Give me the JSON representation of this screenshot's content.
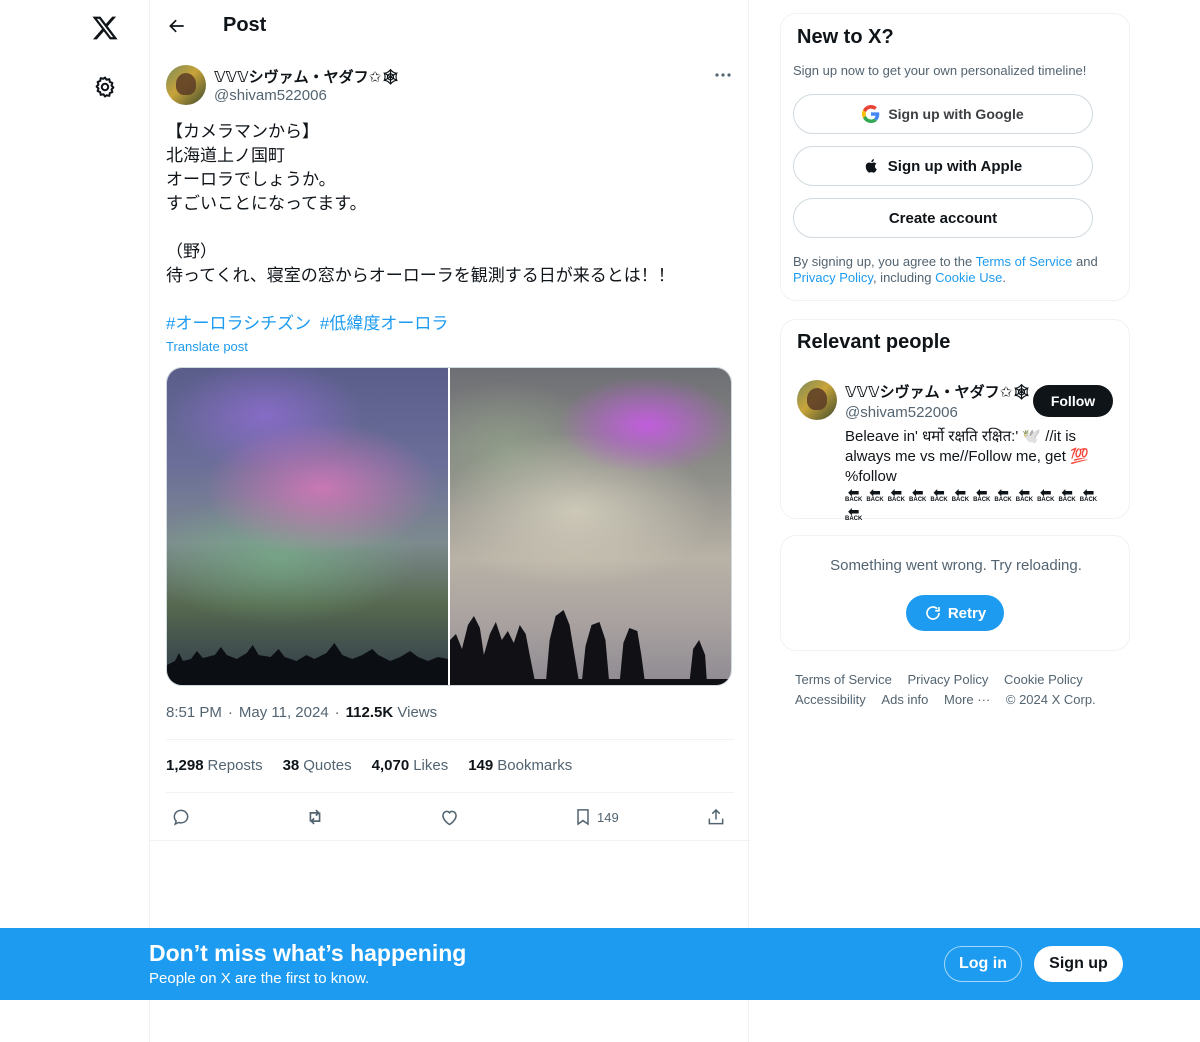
{
  "nav": {
    "logo_icon": "x-logo-icon",
    "settings_icon": "gear-icon"
  },
  "header": {
    "title": "Post",
    "back_icon": "arrow-left-icon"
  },
  "post": {
    "author_name": "𝕍𝕍𝕍シヴァム・ヤダフ✩🕸",
    "author_handle": "@shivam522006",
    "more_icon": "ellipsis-icon",
    "text": "【カメラマンから】\n北海道上ノ国町\nオーロラでしょうか。\nすごいことになってます。\n\n（野）\n待ってくれ、寝室の窓からオーローラを観測する日が来るとは！！",
    "hashtags": [
      "#オーロラシチズン",
      "#低緯度オーロラ"
    ],
    "translate_label": "Translate post",
    "time": "8:51 PM",
    "date": "May 11, 2024",
    "views_count": "112.5K",
    "views_label": "Views",
    "reposts_count": "1,298",
    "reposts_label": "Reposts",
    "quotes_count": "38",
    "quotes_label": "Quotes",
    "likes_count": "4,070",
    "likes_label": "Likes",
    "bookmarks_count": "149",
    "bookmarks_label": "Bookmarks",
    "bookmark_action_count": "149"
  },
  "sidebar": {
    "signup": {
      "title": "New to X?",
      "subtitle": "Sign up now to get your own personalized timeline!",
      "google_label": "Sign up with Google",
      "apple_label": "Sign up with Apple",
      "create_label": "Create account",
      "legal_prefix": "By signing up, you agree to the ",
      "terms_link": "Terms of Service",
      "legal_and": " and",
      "privacy_link": "Privacy Policy",
      "legal_including": ", including ",
      "cookie_link": "Cookie Use",
      "legal_end": "."
    },
    "people": {
      "title": "Relevant people",
      "name": "𝕍𝕍𝕍シヴァム・ヤダフ✩🕸",
      "handle": "@shivam522006",
      "follow_label": "Follow",
      "bio_line": "Beleave in' धर्मो रक्षति रक्षित:' 🕊️ //it is always me vs me//Follow me, get 💯 %follow",
      "back_label": "BACK",
      "back_count": 13
    },
    "error": {
      "message": "Something went wrong. Try reloading.",
      "retry_label": "Retry"
    },
    "footer": {
      "links": [
        "Terms of Service",
        "Privacy Policy",
        "Cookie Policy",
        "Accessibility",
        "Ads info",
        "More ···",
        "© 2024 X Corp."
      ]
    }
  },
  "banner": {
    "title": "Don’t miss what’s happening",
    "subtitle": "People on X are the first to know.",
    "login_label": "Log in",
    "signup_label": "Sign up"
  },
  "colors": {
    "accent": "#1d9bf0",
    "text": "#0f1419",
    "muted": "#536471"
  }
}
